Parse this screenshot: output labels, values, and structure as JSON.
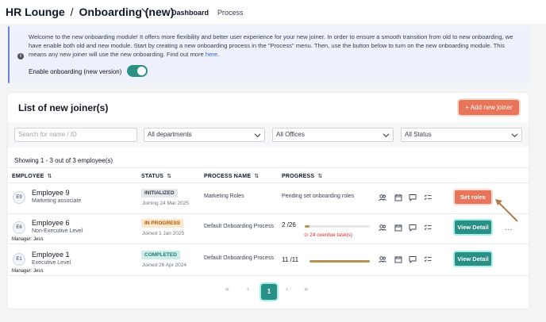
{
  "header": {
    "title": "HR Lounge",
    "separator": "/",
    "section": "Onboarding (new)",
    "tabs": [
      "Dashboard",
      "Process"
    ]
  },
  "banner": {
    "message": "Welcome to the new onboarding module! It offers more flexibility and better user experience for your new joiner. In order to ensure a smooth transition from old to new onboarding, we have enable both old and new module. Start by creating a new onboarding process in the \"Process\" menu. Then, use the button below to turn on the new onboarding module. This means any new joiner will use the new onboarding. Find out more",
    "link": "here",
    "period": ".",
    "toggle_label": "Enable onboarding (new version)",
    "toggle_on": true
  },
  "list": {
    "title": "List of new joiner(s)",
    "add_button": "+ Add new joiner",
    "filters": {
      "search_placeholder": "Search for name / ID",
      "departments": "All departments",
      "offices": "All Offices",
      "status": "All Status"
    },
    "showing": "Showing 1 - 3 out of 3 employee(s)",
    "columns": [
      "EMPLOYEE",
      "STATUS",
      "PROCESS NAME",
      "PROGRESS"
    ],
    "rows": [
      {
        "avatar": "E9",
        "name": "Employee 9",
        "title": "Marketing associate",
        "manager": "",
        "status": "INITIALIZED",
        "date": "Joining 24 Mar 2025",
        "process": "Marketing Roles",
        "progress_text": "Pending set onboarding roles",
        "action": "Set roles"
      },
      {
        "avatar": "E6",
        "name": "Employee 6",
        "title": "Non-Executive Level",
        "manager": "Manager: Jess",
        "status": "IN PROGRESS",
        "date": "Joined 1 Jan 2025",
        "process": "Default Onboarding Process",
        "progress_text": "2 /26",
        "progress": 0.077,
        "overdue": "24 overdue task(s)",
        "action": "View Detail"
      },
      {
        "avatar": "E1",
        "name": "Employee 1",
        "title": "Executive Level",
        "manager": "Manager: Jess",
        "status": "COMPLETED",
        "date": "Joined 26 Apr 2024",
        "process": "Default Onboarding Process",
        "progress_text": "11 /11",
        "progress": 1.0,
        "action": "View Detail"
      }
    ],
    "row_icons": [
      "users-icon",
      "calendar-icon",
      "chat-icon",
      "checklist-icon"
    ],
    "more": "...",
    "pagination": {
      "first": "«",
      "prev": "‹",
      "current": "1",
      "next": "›",
      "last": "»"
    }
  },
  "colors": {
    "accent_teal": "#2a8f84",
    "accent_orange": "#e8745a",
    "progress": "#b8904f",
    "initialized_bg": "#e5e7eb",
    "in_progress_bg": "#fde8cc",
    "completed_bg": "#cdeee8"
  }
}
